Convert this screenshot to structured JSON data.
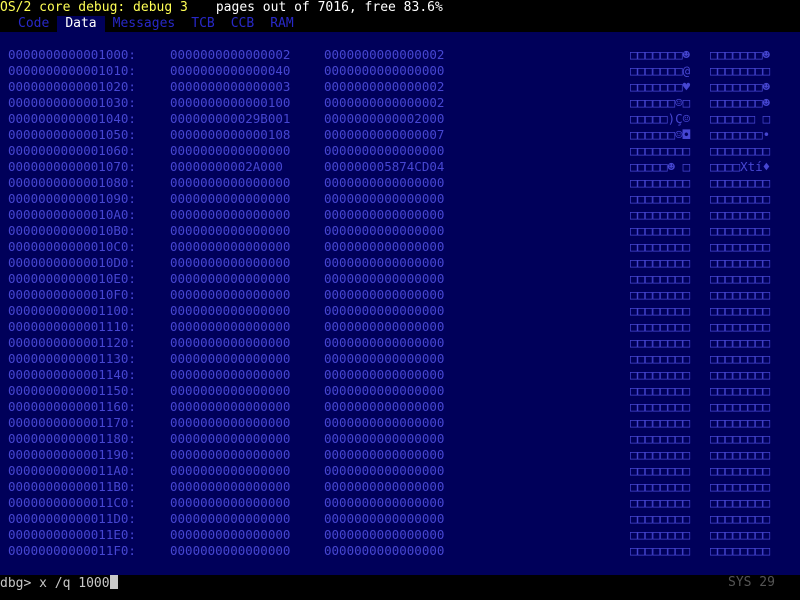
{
  "title": {
    "app": "OS/2 core debug: debug 3",
    "stats": "pages out of 7016, free 83.6%"
  },
  "tabs": [
    {
      "label": "Code",
      "active": false
    },
    {
      "label": "Data",
      "active": true
    },
    {
      "label": "Messages",
      "active": false
    },
    {
      "label": "TCB",
      "active": false
    },
    {
      "label": "CCB",
      "active": false
    },
    {
      "label": "RAM",
      "active": false
    }
  ],
  "dump": [
    {
      "addr": "0000000000001000:",
      "q0": "0000000000000002",
      "q1": "0000000000000002",
      "ascii0": "□□□□□□□☻",
      "ascii1": "□□□□□□□☻"
    },
    {
      "addr": "0000000000001010:",
      "q0": "0000000000000040",
      "q1": "0000000000000000",
      "ascii0": "□□□□□□□@",
      "ascii1": "□□□□□□□□"
    },
    {
      "addr": "0000000000001020:",
      "q0": "0000000000000003",
      "q1": "0000000000000002",
      "ascii0": "□□□□□□□♥",
      "ascii1": "□□□□□□□☻"
    },
    {
      "addr": "0000000000001030:",
      "q0": "0000000000000100",
      "q1": "0000000000000002",
      "ascii0": "□□□□□□☺□",
      "ascii1": "□□□□□□□☻"
    },
    {
      "addr": "0000000000001040:",
      "q0": "000000000029B001",
      "q1": "0000000000002000",
      "ascii0": "□□□□□)Ç☺",
      "ascii1": "□□□□□□ □"
    },
    {
      "addr": "0000000000001050:",
      "q0": "0000000000000108",
      "q1": "0000000000000007",
      "ascii0": "□□□□□□☺◘",
      "ascii1": "□□□□□□□•"
    },
    {
      "addr": "0000000000001060:",
      "q0": "0000000000000000",
      "q1": "0000000000000000",
      "ascii0": "□□□□□□□□",
      "ascii1": "□□□□□□□□"
    },
    {
      "addr": "0000000000001070:",
      "q0": "00000000002A000",
      "q1": "000000005874CD04",
      "ascii0": "□□□□□☻ □",
      "ascii1": "□□□□Xtí♦"
    },
    {
      "addr": "0000000000001080:",
      "q0": "0000000000000000",
      "q1": "0000000000000000",
      "ascii0": "□□□□□□□□",
      "ascii1": "□□□□□□□□"
    },
    {
      "addr": "0000000000001090:",
      "q0": "0000000000000000",
      "q1": "0000000000000000",
      "ascii0": "□□□□□□□□",
      "ascii1": "□□□□□□□□"
    },
    {
      "addr": "00000000000010A0:",
      "q0": "0000000000000000",
      "q1": "0000000000000000",
      "ascii0": "□□□□□□□□",
      "ascii1": "□□□□□□□□"
    },
    {
      "addr": "00000000000010B0:",
      "q0": "0000000000000000",
      "q1": "0000000000000000",
      "ascii0": "□□□□□□□□",
      "ascii1": "□□□□□□□□"
    },
    {
      "addr": "00000000000010C0:",
      "q0": "0000000000000000",
      "q1": "0000000000000000",
      "ascii0": "□□□□□□□□",
      "ascii1": "□□□□□□□□"
    },
    {
      "addr": "00000000000010D0:",
      "q0": "0000000000000000",
      "q1": "0000000000000000",
      "ascii0": "□□□□□□□□",
      "ascii1": "□□□□□□□□"
    },
    {
      "addr": "00000000000010E0:",
      "q0": "0000000000000000",
      "q1": "0000000000000000",
      "ascii0": "□□□□□□□□",
      "ascii1": "□□□□□□□□"
    },
    {
      "addr": "00000000000010F0:",
      "q0": "0000000000000000",
      "q1": "0000000000000000",
      "ascii0": "□□□□□□□□",
      "ascii1": "□□□□□□□□"
    },
    {
      "addr": "0000000000001100:",
      "q0": "0000000000000000",
      "q1": "0000000000000000",
      "ascii0": "□□□□□□□□",
      "ascii1": "□□□□□□□□"
    },
    {
      "addr": "0000000000001110:",
      "q0": "0000000000000000",
      "q1": "0000000000000000",
      "ascii0": "□□□□□□□□",
      "ascii1": "□□□□□□□□"
    },
    {
      "addr": "0000000000001120:",
      "q0": "0000000000000000",
      "q1": "0000000000000000",
      "ascii0": "□□□□□□□□",
      "ascii1": "□□□□□□□□"
    },
    {
      "addr": "0000000000001130:",
      "q0": "0000000000000000",
      "q1": "0000000000000000",
      "ascii0": "□□□□□□□□",
      "ascii1": "□□□□□□□□"
    },
    {
      "addr": "0000000000001140:",
      "q0": "0000000000000000",
      "q1": "0000000000000000",
      "ascii0": "□□□□□□□□",
      "ascii1": "□□□□□□□□"
    },
    {
      "addr": "0000000000001150:",
      "q0": "0000000000000000",
      "q1": "0000000000000000",
      "ascii0": "□□□□□□□□",
      "ascii1": "□□□□□□□□"
    },
    {
      "addr": "0000000000001160:",
      "q0": "0000000000000000",
      "q1": "0000000000000000",
      "ascii0": "□□□□□□□□",
      "ascii1": "□□□□□□□□"
    },
    {
      "addr": "0000000000001170:",
      "q0": "0000000000000000",
      "q1": "0000000000000000",
      "ascii0": "□□□□□□□□",
      "ascii1": "□□□□□□□□"
    },
    {
      "addr": "0000000000001180:",
      "q0": "0000000000000000",
      "q1": "0000000000000000",
      "ascii0": "□□□□□□□□",
      "ascii1": "□□□□□□□□"
    },
    {
      "addr": "0000000000001190:",
      "q0": "0000000000000000",
      "q1": "0000000000000000",
      "ascii0": "□□□□□□□□",
      "ascii1": "□□□□□□□□"
    },
    {
      "addr": "00000000000011A0:",
      "q0": "0000000000000000",
      "q1": "0000000000000000",
      "ascii0": "□□□□□□□□",
      "ascii1": "□□□□□□□□"
    },
    {
      "addr": "00000000000011B0:",
      "q0": "0000000000000000",
      "q1": "0000000000000000",
      "ascii0": "□□□□□□□□",
      "ascii1": "□□□□□□□□"
    },
    {
      "addr": "00000000000011C0:",
      "q0": "0000000000000000",
      "q1": "0000000000000000",
      "ascii0": "□□□□□□□□",
      "ascii1": "□□□□□□□□"
    },
    {
      "addr": "00000000000011D0:",
      "q0": "0000000000000000",
      "q1": "0000000000000000",
      "ascii0": "□□□□□□□□",
      "ascii1": "□□□□□□□□"
    },
    {
      "addr": "00000000000011E0:",
      "q0": "0000000000000000",
      "q1": "0000000000000000",
      "ascii0": "□□□□□□□□",
      "ascii1": "□□□□□□□□"
    },
    {
      "addr": "00000000000011F0:",
      "q0": "0000000000000000",
      "q1": "0000000000000000",
      "ascii0": "□□□□□□□□",
      "ascii1": "□□□□□□□□"
    }
  ],
  "command": {
    "prompt": "dbg> ",
    "input": "x /q 1000"
  },
  "status": {
    "sys_label": "SYS 29"
  },
  "colors": {
    "background": "#00005a",
    "title_text": "#ffff55",
    "tab_inactive": "#2828c8",
    "tab_active": "#ffffff",
    "dump_text": "#4646d2",
    "prompt_text": "#c8c8c8"
  }
}
